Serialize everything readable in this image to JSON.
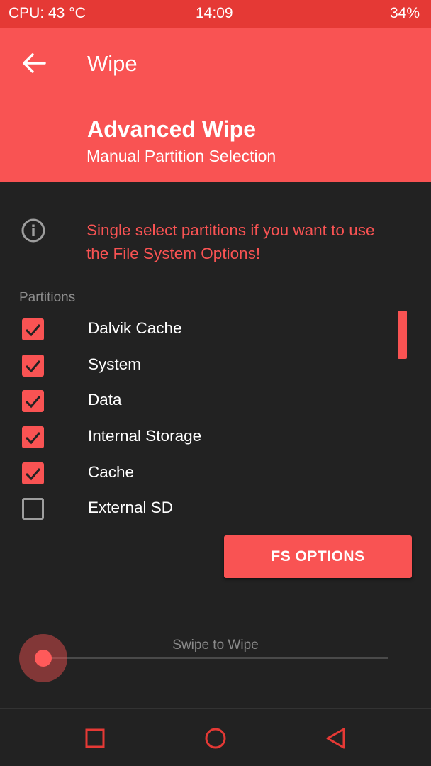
{
  "status_bar": {
    "cpu": "CPU: 43 °C",
    "time": "14:09",
    "battery": "34%"
  },
  "header": {
    "title": "Wipe",
    "subtitle": "Advanced Wipe",
    "description": "Manual Partition Selection",
    "back_icon": "arrow-left-icon"
  },
  "info": {
    "icon": "info-icon",
    "text": "Single select partitions if you want to use the File System Options!"
  },
  "partitions": {
    "label": "Partitions",
    "items": [
      {
        "label": "Dalvik Cache",
        "checked": true
      },
      {
        "label": "System",
        "checked": true
      },
      {
        "label": "Data",
        "checked": true
      },
      {
        "label": "Internal Storage",
        "checked": true
      },
      {
        "label": "Cache",
        "checked": true
      },
      {
        "label": "External SD",
        "checked": false
      }
    ]
  },
  "fs_button": {
    "label": "FS OPTIONS"
  },
  "swipe": {
    "label": "Swipe to Wipe"
  },
  "nav": {
    "recent_icon": "square-icon",
    "home_icon": "circle-icon",
    "back_icon": "triangle-back-icon"
  },
  "colors": {
    "accent": "#f95353",
    "status_bar": "#e53935",
    "background": "#222222"
  }
}
